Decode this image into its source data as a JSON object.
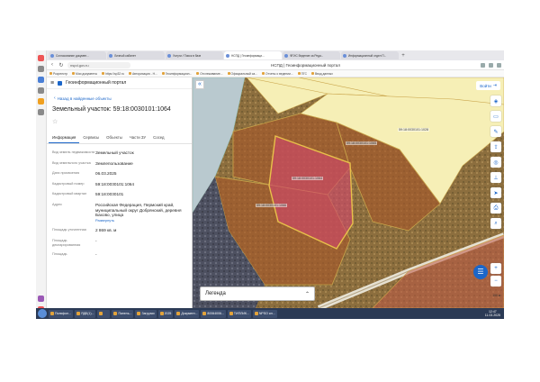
{
  "browser": {
    "tabs": [
      {
        "label": "Согласование докумен..."
      },
      {
        "label": "Личный кабинет"
      },
      {
        "label": "Услуги / Поиск в базе"
      },
      {
        "label": "НСПД | Геоинформаци..."
      },
      {
        "label": "ФГИС Ведение за Реда..."
      },
      {
        "label": "Информационный отдел П..."
      }
    ],
    "active_tab_index": 3,
    "new_tab": "+",
    "url": "nspd.gov.ru",
    "page_title": "НСПД | Геоинформационный портал",
    "bookmarks": [
      "Росреестр",
      "Мои документы",
      "https://sp32.ru",
      "Авторизация - Н...",
      "Геоинформацион...",
      "Отслеживание...",
      "Официальный са...",
      "Отчеты о ведении...",
      "ПГС",
      "Ввод данных"
    ]
  },
  "panel": {
    "menu_icon": "≡",
    "portal_name": "Геоинформационный портал",
    "back_label": "Назад в найденные объекты",
    "title": "Земельный участок: 59:18:0030101:1064",
    "star": "☆",
    "tabs": [
      "Информация",
      "Сервисы",
      "Объекты",
      "Части ЗУ",
      "Сосед"
    ],
    "properties": [
      {
        "key": "Вид земель недвижимости",
        "value": "Земельный участок"
      },
      {
        "key": "Вид земельного участка",
        "value": "Землепользование"
      },
      {
        "key": "Дата присвоения",
        "value": "06.03.2025"
      },
      {
        "key": "Кадастровый номер",
        "value": "59:18:0030101:1064"
      },
      {
        "key": "Кадастровый квартал",
        "value": "59:18:0030101"
      },
      {
        "key": "Адрес",
        "value": "Российская Федерация, Пермский край, муниципальный округ Добрянский, деревня Бахово, улица"
      },
      {
        "key": "Площадь уточненная",
        "value": "2 869 кв. м"
      },
      {
        "key": "Площадь декларированная",
        "value": "-"
      },
      {
        "key": "Площадь",
        "value": "-"
      }
    ],
    "more_link": "Развернуть"
  },
  "map": {
    "collapse_icon": "«",
    "login_label": "Войти",
    "labels": [
      "59:18:0030101:1028",
      "59:18:0030101:1064",
      "59:18:0030101:1065",
      "59:18:0030101:1066"
    ],
    "legend": "Легенда",
    "legend_chevron": "⌃",
    "scale": "100 м",
    "chat_icon": "☰"
  },
  "taskbar": {
    "items": [
      "Полифон...",
      "ЯДБ(1)...",
      "",
      "Панель...",
      "Загрузки",
      "2025",
      "Документ...",
      "80064006...",
      "ТИПЛИК...",
      "NPSO ил..."
    ],
    "clock": "12:47",
    "date": "11.03.2025"
  },
  "colors": {
    "accent": "#1b66c9",
    "parcel_selected": "#d2476c",
    "parcel_adjacent": "#a6572a",
    "pale_yellow_parcel": "#f6efb6"
  }
}
